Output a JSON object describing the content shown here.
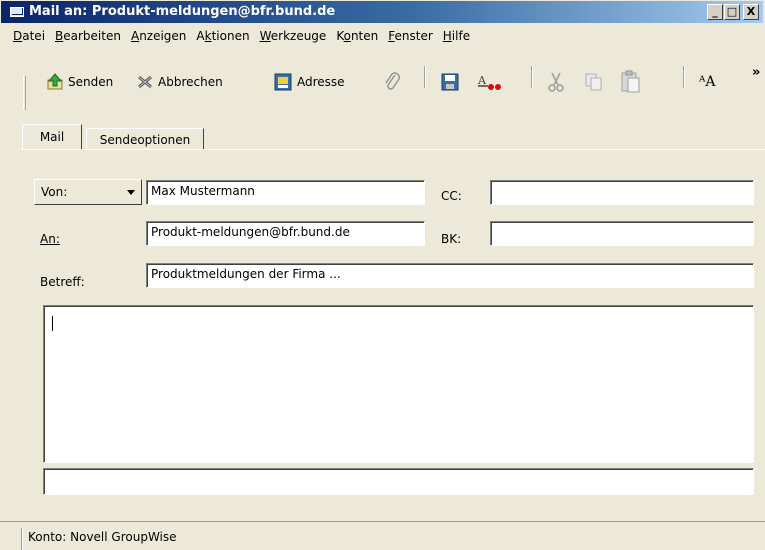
{
  "window": {
    "title": "Mail an: Produkt-meldungen@bfr.bund.de",
    "controls": {
      "minimize": "_",
      "maximize": "□",
      "close": "X"
    }
  },
  "menubar": {
    "items": [
      {
        "label": "Datei",
        "accel_index": 0
      },
      {
        "label": "Bearbeiten",
        "accel_index": 0
      },
      {
        "label": "Anzeigen",
        "accel_index": 0
      },
      {
        "label": "Aktionen",
        "accel_index": 1
      },
      {
        "label": "Werkzeuge",
        "accel_index": 0
      },
      {
        "label": "Konten",
        "accel_index": 1
      },
      {
        "label": "Fenster",
        "accel_index": 0
      },
      {
        "label": "Hilfe",
        "accel_index": 0
      }
    ]
  },
  "toolbar": {
    "send_label": "Senden",
    "cancel_label": "Abbrechen",
    "address_label": "Adresse",
    "overflow": "»",
    "icons": [
      "send-icon",
      "cancel-icon",
      "address-book-icon",
      "attach-icon",
      "save-icon",
      "spellcheck-icon",
      "cut-icon",
      "copy-icon",
      "paste-icon",
      "font-icon"
    ],
    "font_glyph": "ᴬA"
  },
  "tabs": {
    "mail": "Mail",
    "send_options": "Sendeoptionen"
  },
  "form": {
    "from_label": "Von:",
    "from_value": "Max Mustermann",
    "to_label": "An:",
    "to_value": "Produkt-meldungen@bfr.bund.de",
    "subject_label": "Betreff:",
    "subject_value": "Produktmeldungen der Firma ...",
    "cc_label": "CC:",
    "cc_value": "",
    "bcc_label": "BK:",
    "bcc_value": ""
  },
  "status": {
    "account": "Konto: Novell GroupWise"
  },
  "colors": {
    "titlebar_start": "#0a246a",
    "titlebar_end": "#a6caf0",
    "face": "#ece9d8"
  }
}
